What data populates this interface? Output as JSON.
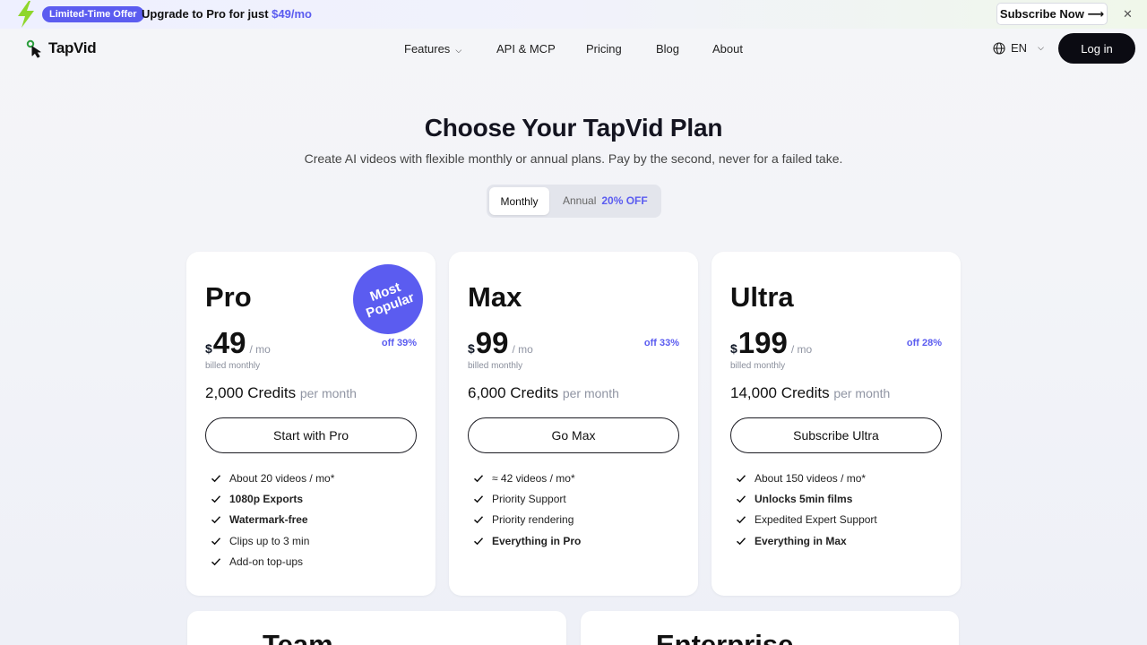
{
  "promo": {
    "badge": "Limited-Time Offer",
    "message_prefix": "Upgrade to Pro for just ",
    "message_price": "$49/mo",
    "subscribe_label": "Subscribe Now ⟶",
    "close_label": "✕",
    "icon": "lightning-bolt-icon",
    "bolt_color": "#8ed62c"
  },
  "nav": {
    "brand": "TapVid",
    "items": [
      {
        "label": "Features",
        "has_dropdown": true
      },
      {
        "label": "API & MCP"
      },
      {
        "label": "Pricing"
      },
      {
        "label": "Blog"
      },
      {
        "label": "About"
      }
    ],
    "language": "EN",
    "login_label": "Log in"
  },
  "hero": {
    "title": "Choose Your TapVid Plan",
    "subtitle": "Create AI videos with flexible monthly or annual plans. Pay by the second, never for a failed take."
  },
  "billing_toggle": {
    "monthly_label": "Monthly",
    "annual_label": "Annual",
    "annual_discount": "20% OFF",
    "selected": "Monthly"
  },
  "plans": [
    {
      "name": "Pro",
      "currency": "$",
      "price": "49",
      "period": "/ mo",
      "discount": "off 39%",
      "billed": "billed monthly",
      "credits": "2,000 Credits",
      "credits_suffix": "per month",
      "cta": "Start with Pro",
      "badge": {
        "line1": "Most",
        "line2": "Popular"
      },
      "features": [
        {
          "text": "About 20 videos / mo*",
          "bold": false
        },
        {
          "text": "1080p Exports",
          "bold": true
        },
        {
          "text": "Watermark-free",
          "bold": true
        },
        {
          "text": "Clips up to 3 min",
          "bold": false
        },
        {
          "text": "Add-on top-ups",
          "bold": false
        }
      ]
    },
    {
      "name": "Max",
      "currency": "$",
      "price": "99",
      "period": "/ mo",
      "discount": "off 33%",
      "billed": "billed monthly",
      "credits": "6,000 Credits",
      "credits_suffix": "per month",
      "cta": "Go Max",
      "features": [
        {
          "text": "≈ 42 videos / mo*",
          "bold": false
        },
        {
          "text": "Priority Support",
          "bold": false
        },
        {
          "text": "Priority rendering",
          "bold": false
        },
        {
          "text": "Everything in Pro",
          "bold": true
        }
      ]
    },
    {
      "name": "Ultra",
      "currency": "$",
      "price": "199",
      "period": "/ mo",
      "discount": "off 28%",
      "billed": "billed monthly",
      "credits": "14,000 Credits",
      "credits_suffix": "per month",
      "cta": "Subscribe Ultra",
      "features": [
        {
          "text": "About 150 videos / mo*",
          "bold": false
        },
        {
          "text": "Unlocks 5min films",
          "bold": true
        },
        {
          "text": "Expedited Expert Support",
          "bold": false
        },
        {
          "text": "Everything in Max",
          "bold": true
        }
      ]
    }
  ],
  "bottom_plans": [
    {
      "name": "Team"
    },
    {
      "name": "Enterprise"
    }
  ],
  "colors": {
    "accent": "#5b5cf0",
    "dark": "#0b0b12"
  }
}
